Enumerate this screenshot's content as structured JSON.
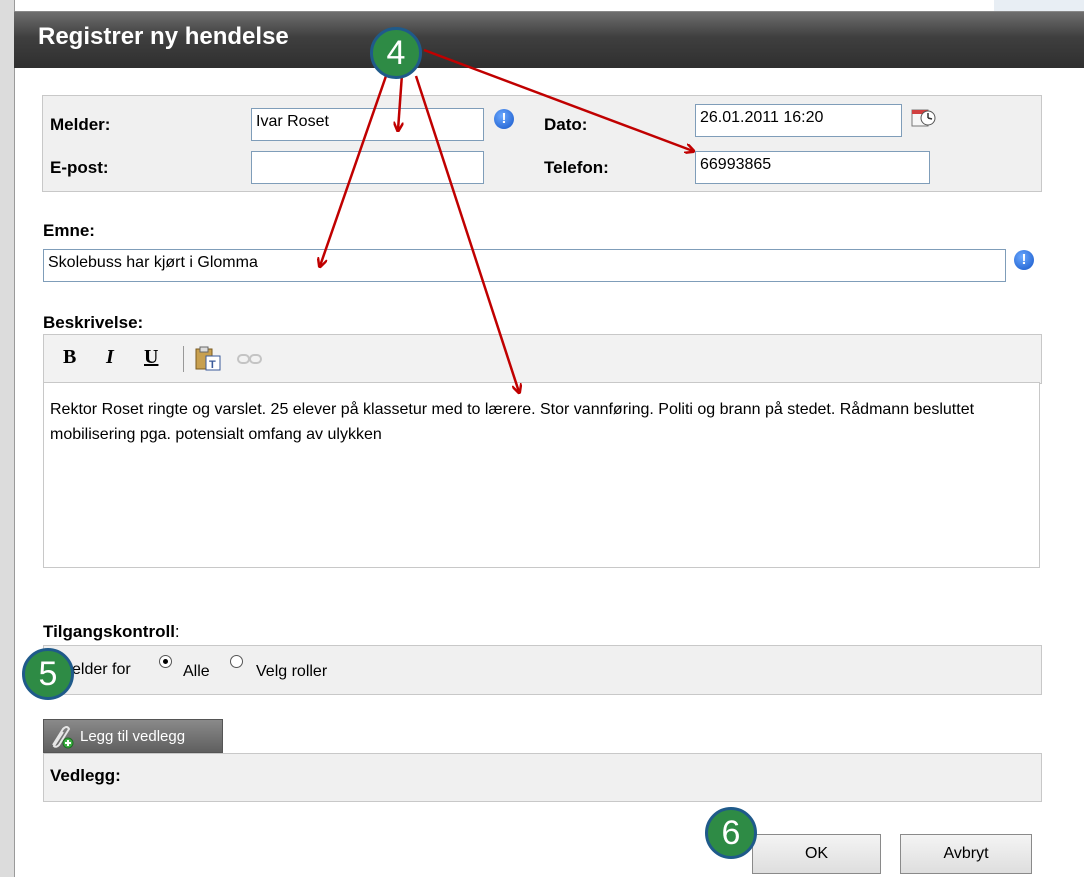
{
  "dialog": {
    "title": "Registrer ny hendelse"
  },
  "reporter_panel": {
    "melder_label": "Melder:",
    "melder_value": "Ivar Roset",
    "epost_label": "E-post:",
    "epost_value": "",
    "dato_label": "Dato:",
    "dato_value": "26.01.2011 16:20",
    "telefon_label": "Telefon:",
    "telefon_value": "66993865",
    "info_glyph": "!"
  },
  "subject": {
    "label": "Emne:",
    "value": "Skolebuss har kjørt i Glomma",
    "info_glyph": "!"
  },
  "description": {
    "label": "Beskrivelse:",
    "toolbar": {
      "bold": "B",
      "italic": "I",
      "underline": "U"
    },
    "text": "Rektor Roset ringte og varslet. 25 elever på klassetur med to lærere. Stor vannføring. Politi og brann på stedet. Rådmann besluttet mobilisering pga. potensialt omfang av ulykken"
  },
  "access": {
    "label": "Tilgangskontroll",
    "label_colon": ":",
    "applies_label": "Gjelder for",
    "options": [
      "Alle",
      "Velg roller"
    ],
    "selected": "Alle"
  },
  "attachments": {
    "add_button": "Legg til vedlegg",
    "label": "Vedlegg:"
  },
  "buttons": {
    "ok": "OK",
    "cancel": "Avbryt"
  },
  "annotations": {
    "badge_4": "4",
    "badge_5": "5",
    "badge_6": "6",
    "badge_color": "#2e8b45",
    "arrow_color": "#c00000"
  }
}
